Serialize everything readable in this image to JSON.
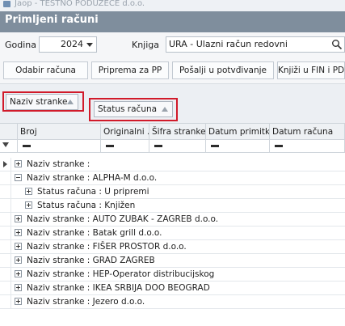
{
  "window": {
    "title": "Jaop - TESTNO PODUZECE d.o.o."
  },
  "header": {
    "title": "Primljeni računi"
  },
  "filters": {
    "year_label": "Godina",
    "year_value": "2024",
    "book_label": "Knjiga",
    "book_value": "URA - Ulazni račun redovni"
  },
  "toolbar": {
    "buttons": [
      "Odabir računa",
      "Priprema za PP",
      "Pošalji u potvđivanje",
      "Knjiži u FIN i PD"
    ]
  },
  "grouping": {
    "chips": [
      "Naziv stranke",
      "Status računa"
    ]
  },
  "grid": {
    "columns": [
      "Broj",
      "Originalni ...",
      "Šifra stranke",
      "Datum primitka",
      "Datum računa"
    ],
    "groups": [
      {
        "text": "Naziv stranke :",
        "expanded": false,
        "level": 0,
        "current": true
      },
      {
        "text": "Naziv stranke : ALPHA-M d.o.o.",
        "expanded": true,
        "level": 0
      },
      {
        "text": "Status računa : U pripremi",
        "expanded": false,
        "level": 1
      },
      {
        "text": "Status računa : Knjižen",
        "expanded": false,
        "level": 1
      },
      {
        "text": "Naziv stranke : AUTO ZUBAK - ZAGREB d.o.o.",
        "expanded": false,
        "level": 0
      },
      {
        "text": "Naziv stranke : Batak grill d.o.o.",
        "expanded": false,
        "level": 0
      },
      {
        "text": "Naziv stranke : FIŠER PROSTOR d.o.o.",
        "expanded": false,
        "level": 0
      },
      {
        "text": "Naziv stranke : GRAD ZAGREB",
        "expanded": false,
        "level": 0
      },
      {
        "text": "Naziv stranke : HEP-Operator distribucijskog",
        "expanded": false,
        "level": 0
      },
      {
        "text": "Naziv stranke : IKEA SRBIJA DOO BEOGRAD",
        "expanded": false,
        "level": 0
      },
      {
        "text": "Naziv stranke : Jezero d.o.o.",
        "expanded": false,
        "level": 0
      }
    ]
  },
  "colors": {
    "header_bg": "#7f8e9d",
    "highlight_frame": "#d11a2a"
  }
}
